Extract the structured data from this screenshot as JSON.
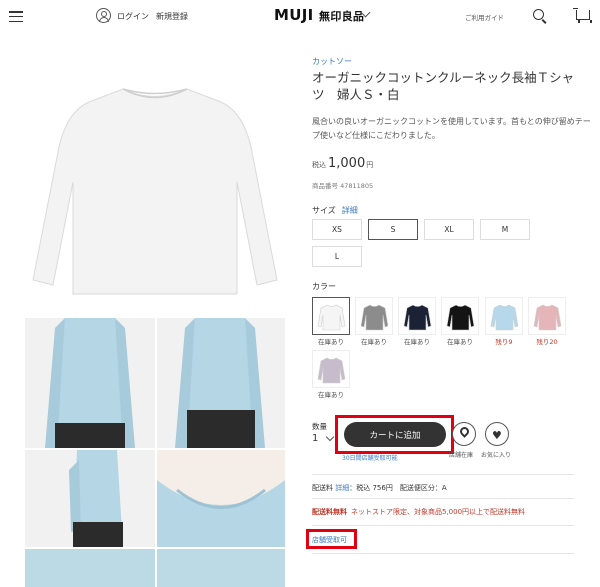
{
  "header": {
    "login": "ログイン",
    "register": "新規登録",
    "logo_main": "MUJI",
    "logo_sub": "無印良品",
    "guide": "ご利用ガイド"
  },
  "product": {
    "category": "カットソー",
    "title": "オーガニックコットンクルーネック長袖Ｔシャツ　婦人Ｓ・白",
    "description": "風合いの良いオーガニックコットンを使用しています。首もとの伸び留めテープ使いなど仕様にこだわりました。",
    "price_prefix": "税込",
    "price": "1,000",
    "price_suffix": "円",
    "product_no": "商品番号 47811805"
  },
  "size": {
    "label": "サイズ",
    "detail": "詳細",
    "options": [
      "XS",
      "S",
      "XL",
      "M",
      "L"
    ],
    "selected": "S"
  },
  "color": {
    "label": "カラー",
    "swatches": [
      {
        "name": "white",
        "hex": "#f5f5f5",
        "stock": "在庫あり"
      },
      {
        "name": "gray",
        "hex": "#8c8c8c",
        "stock": "在庫あり"
      },
      {
        "name": "navy",
        "hex": "#1c2235",
        "stock": "在庫あり"
      },
      {
        "name": "black",
        "hex": "#141414",
        "stock": "在庫あり"
      },
      {
        "name": "light-blue",
        "hex": "#b6d8ea",
        "stock": "残り9"
      },
      {
        "name": "pink",
        "hex": "#e6b5b9",
        "stock": "残り20"
      },
      {
        "name": "lavender",
        "hex": "#c7bccb",
        "stock": "在庫あり"
      }
    ]
  },
  "purchase": {
    "qty_label": "数量",
    "qty_value": "1",
    "cart_button": "カートに追加",
    "store_stock": "店舗在庫",
    "favorite": "お気に入り",
    "pickup_note": "30日間店舗受取可能"
  },
  "shipping": {
    "label": "配送料",
    "detail": "詳細",
    "text": "：税込 756円　配送便区分：A",
    "free_label": "配送料無料",
    "free_note": "ネットストア限定、対象商品5,000円以上で配送料無料"
  },
  "store_pickup": "店舗受取可",
  "colors": {
    "accent": "#3b7ac2",
    "highlight": "#e0000f",
    "button": "#333333"
  }
}
